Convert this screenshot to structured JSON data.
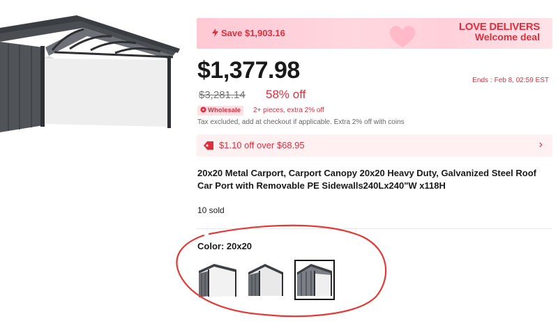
{
  "promo": {
    "save_text": "Save $1,903.16",
    "brand_line1": "LOVE DELIVERS",
    "brand_line2": "Welcome deal"
  },
  "pricing": {
    "price": "$1,377.98",
    "original_price": "$3,281.14",
    "discount": "58% off",
    "ends_label": "Ends :",
    "ends_value": "Feb 8, 02:59 EST"
  },
  "wholesale": {
    "badge": "Wholesale",
    "text": "2+ pieces, extra 2% off"
  },
  "tax_note": "Tax excluded, add at checkout if applicable. Extra 2% off with coins",
  "coupon": {
    "text": "$1.10 off over $68.95",
    "chevron": "›"
  },
  "product": {
    "title": "20x20 Metal Carport, Carport Canopy 20x20 Heavy Duty, Galvanized Steel Roof Car Port with Removable PE Sidewalls240Lx240\"W x118H",
    "sold": "10 sold"
  },
  "variants": {
    "label": "Color: 20x20",
    "options": [
      "option-1",
      "option-2",
      "option-3"
    ],
    "selected_index": 2
  },
  "colors": {
    "accent": "#e02e3d",
    "promo_bg": "#ffd0da",
    "coupon_bg": "#fff0f2",
    "annotation": "#e53935"
  }
}
